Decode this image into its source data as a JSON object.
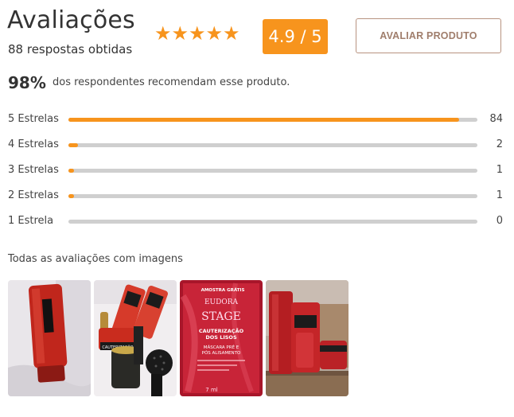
{
  "header": {
    "title": "Avaliações",
    "subtitle": "88 respostas obtidas",
    "stars": 5,
    "score": "4.9 / 5",
    "rate_button": "AVALIAR PRODUTO"
  },
  "recommend": {
    "percent": "98%",
    "text": "dos respondentes recomendam esse produto."
  },
  "ratings": [
    {
      "label": "5 Estrelas",
      "count": "84",
      "fraction": 0.955
    },
    {
      "label": "4 Estrelas",
      "count": "2",
      "fraction": 0.023
    },
    {
      "label": "3 Estrelas",
      "count": "1",
      "fraction": 0.011
    },
    {
      "label": "2 Estrelas",
      "count": "1",
      "fraction": 0.011
    },
    {
      "label": "1 Estrela",
      "count": "0",
      "fraction": 0
    }
  ],
  "images_section": {
    "title": "Todas as avaliações com imagens",
    "photo2_text": "CAUTERIZAÇÃO",
    "photo3_texts": [
      "AMOSTRA GRÁTIS",
      "EUDORA",
      "STAGE",
      "CAUTERIZAÇÃO",
      "DOS LISOS",
      "MÁSCARA PRÉ E",
      "PÓS ALISAMENTO",
      "7 ml"
    ]
  },
  "colors": {
    "accent": "#f7941d",
    "track": "#cfcfcf",
    "button_border": "#b89380"
  }
}
